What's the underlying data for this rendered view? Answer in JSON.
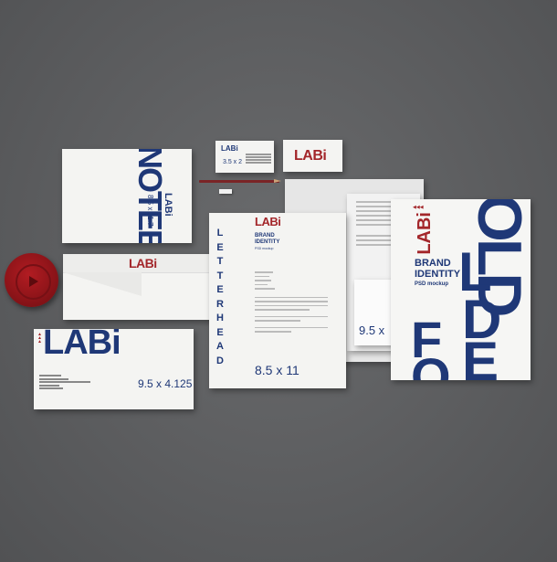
{
  "brand": {
    "logo": "LABi",
    "colors": {
      "blue": "#1f3877",
      "red": "#a3262a",
      "background": "#5e5f61",
      "paper": "#f4f4f2"
    }
  },
  "notebook": {
    "title": "NOTEBOOK",
    "size": "8.5 x 11.7"
  },
  "business_card": {
    "size": "3.5 x 2"
  },
  "envelope_small": {
    "logo": "LABi"
  },
  "envelope_large": {
    "size": "9.5 x 4.125"
  },
  "letterhead": {
    "vertical_text": "LETTERHEAD",
    "heading_line1": "BRAND",
    "heading_line2": "IDENTITY",
    "sub": "PSD mockup",
    "size": "8.5 x 11"
  },
  "back_sheet": {
    "size": "9.5 x"
  },
  "folder": {
    "big_text_top": "OLD",
    "big_text_bottom": "FOLDER",
    "heading_line1": "BRAND",
    "heading_line2": "IDENTITY",
    "sub": "PSD mockup"
  },
  "icons": [
    "coffee-cup-lid-icon",
    "pencil-icon",
    "eraser-icon"
  ]
}
